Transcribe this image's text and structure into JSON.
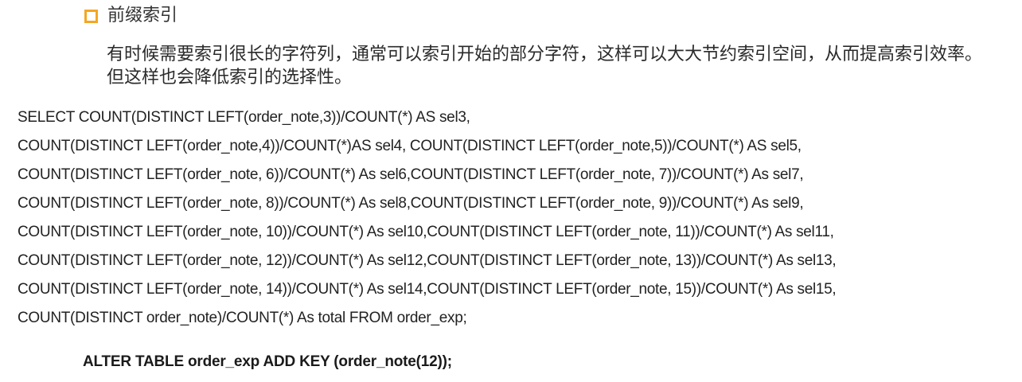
{
  "section": {
    "bullet_icon": "hollow-square-bullet",
    "bullet_color": "#f5a623",
    "title": "前缀索引",
    "description": "有时候需要索引很长的字符列，通常可以索引开始的部分字符，这样可以大大节约索引空间，从而提高索引效率。但这样也会降低索引的选择性。"
  },
  "sql_lines": [
    "SELECT COUNT(DISTINCT LEFT(order_note,3))/COUNT(*) AS sel3,",
    "COUNT(DISTINCT LEFT(order_note,4))/COUNT(*)AS sel4, COUNT(DISTINCT LEFT(order_note,5))/COUNT(*) AS sel5,",
    "COUNT(DISTINCT LEFT(order_note, 6))/COUNT(*) As sel6,COUNT(DISTINCT LEFT(order_note, 7))/COUNT(*) As sel7,",
    "COUNT(DISTINCT LEFT(order_note, 8))/COUNT(*) As sel8,COUNT(DISTINCT LEFT(order_note, 9))/COUNT(*) As sel9,",
    "COUNT(DISTINCT LEFT(order_note, 10))/COUNT(*) As sel10,COUNT(DISTINCT LEFT(order_note, 11))/COUNT(*) As sel11,",
    "COUNT(DISTINCT LEFT(order_note, 12))/COUNT(*) As sel12,COUNT(DISTINCT LEFT(order_note, 13))/COUNT(*) As sel13,",
    "COUNT(DISTINCT LEFT(order_note, 14))/COUNT(*) As sel14,COUNT(DISTINCT LEFT(order_note, 15))/COUNT(*) As sel15,",
    "COUNT(DISTINCT order_note)/COUNT(*) As total  FROM order_exp;"
  ],
  "alter_statement": "ALTER TABLE order_exp ADD KEY (order_note(12));"
}
